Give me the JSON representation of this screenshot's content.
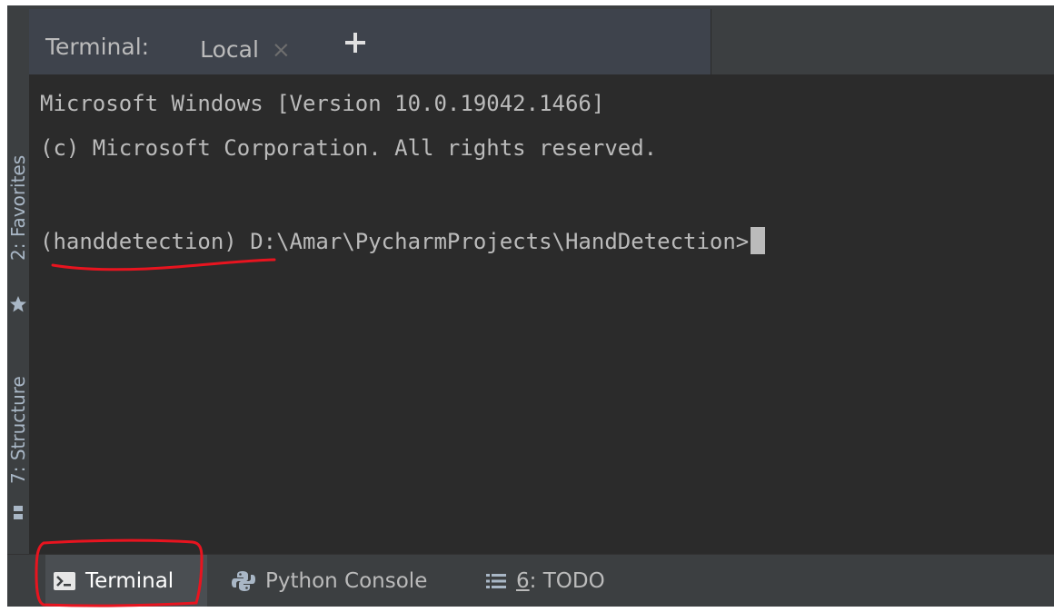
{
  "tabbar": {
    "title": "Terminal:",
    "active_tab": "Local",
    "close_glyph": "×",
    "add_icon": "plus-icon"
  },
  "side_strip": {
    "favorites_label": "2: Favorites",
    "structure_label": "7: Structure"
  },
  "terminal": {
    "line1": "Microsoft Windows [Version 10.0.19042.1466]",
    "line2": "(c) Microsoft Corporation. All rights reserved.",
    "prompt": "(handdetection) D:\\Amar\\PycharmProjects\\HandDetection>"
  },
  "bottombar": {
    "terminal_label": "Terminal",
    "python_console_label": "Python Console",
    "todo_number": "6",
    "todo_label": ": TODO"
  },
  "colors": {
    "background": "#2b2b2b",
    "panel": "#3c3f41",
    "text": "#bbbbbb",
    "accent": "#4a88c7",
    "annotation": "#e8141f"
  }
}
